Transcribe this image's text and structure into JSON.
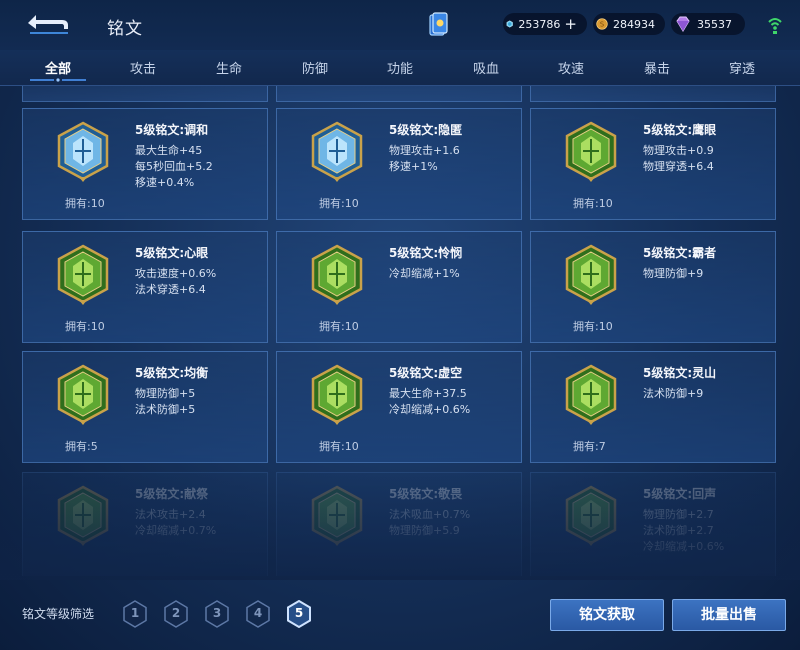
{
  "header": {
    "title": "铭文",
    "currencies": [
      {
        "icon": "diamond-icon",
        "value": "253786",
        "has_plus": true
      },
      {
        "icon": "gold-coin-icon",
        "value": "284934"
      },
      {
        "icon": "purple-gem-icon",
        "value": "35537"
      }
    ]
  },
  "tabs": [
    "全部",
    "攻击",
    "生命",
    "防御",
    "功能",
    "吸血",
    "攻速",
    "暴击",
    "穿透"
  ],
  "active_tab": "全部",
  "owned_prefix": "拥有:",
  "cards": [
    {
      "name": "5级铭文:调和",
      "stats": [
        "最大生命+45",
        "每5秒回血+5.2",
        "移速+0.4%"
      ],
      "owned": "10",
      "color": "blue",
      "icon": "teardrop-emblem-icon"
    },
    {
      "name": "5级铭文:隐匿",
      "stats": [
        "物理攻击+1.6",
        "移速+1%"
      ],
      "owned": "10",
      "color": "blue",
      "icon": "flame-emblem-icon"
    },
    {
      "name": "5级铭文:鹰眼",
      "stats": [
        "物理攻击+0.9",
        "物理穿透+6.4"
      ],
      "owned": "10",
      "color": "green",
      "icon": "octagon-emblem-icon"
    },
    {
      "name": "5级铭文:心眼",
      "stats": [
        "攻击速度+0.6%",
        "法术穿透+6.4"
      ],
      "owned": "10",
      "color": "green",
      "icon": "hexagon-emblem-icon"
    },
    {
      "name": "5级铭文:怜悯",
      "stats": [
        "冷却缩减+1%"
      ],
      "owned": "10",
      "color": "green",
      "icon": "star-emblem-icon"
    },
    {
      "name": "5级铭文:霸者",
      "stats": [
        "物理防御+9"
      ],
      "owned": "10",
      "color": "green",
      "icon": "shield-emblem-icon"
    },
    {
      "name": "5级铭文:均衡",
      "stats": [
        "物理防御+5",
        "法术防御+5"
      ],
      "owned": "5",
      "color": "green",
      "icon": "diamond-emblem-icon"
    },
    {
      "name": "5级铭文:虚空",
      "stats": [
        "最大生命+37.5",
        "冷却缩减+0.6%"
      ],
      "owned": "10",
      "color": "green",
      "icon": "hexagon-emblem-icon"
    },
    {
      "name": "5级铭文:灵山",
      "stats": [
        "法术防御+9"
      ],
      "owned": "7",
      "color": "green",
      "icon": "triangle-emblem-icon"
    },
    {
      "name": "5级铭文:献祭",
      "stats": [
        "法术攻击+2.4",
        "冷却缩减+0.7%"
      ],
      "owned": "",
      "color": "green",
      "icon": "hexagon-emblem-icon",
      "faded": true
    },
    {
      "name": "5级铭文:敬畏",
      "stats": [
        "法术吸血+0.7%",
        "物理防御+5.9"
      ],
      "owned": "",
      "color": "green",
      "icon": "hexagon-emblem-icon",
      "faded": true
    },
    {
      "name": "5级铭文:回声",
      "stats": [
        "物理防御+2.7",
        "法术防御+2.7",
        "冷却缩减+0.6%"
      ],
      "owned": "",
      "color": "green",
      "icon": "circle-emblem-icon",
      "faded": true
    }
  ],
  "filter": {
    "label": "铭文等级筛选",
    "levels": [
      "1",
      "2",
      "3",
      "4",
      "5"
    ],
    "active_level": "5"
  },
  "buttons": {
    "acquire": "铭文获取",
    "bulk_sell": "批量出售"
  },
  "colors": {
    "accent_blue": "#3c73c2",
    "emblem_gold": "#c9a24a",
    "emblem_green": "#5ea832",
    "emblem_blue": "#6fb6e6"
  }
}
